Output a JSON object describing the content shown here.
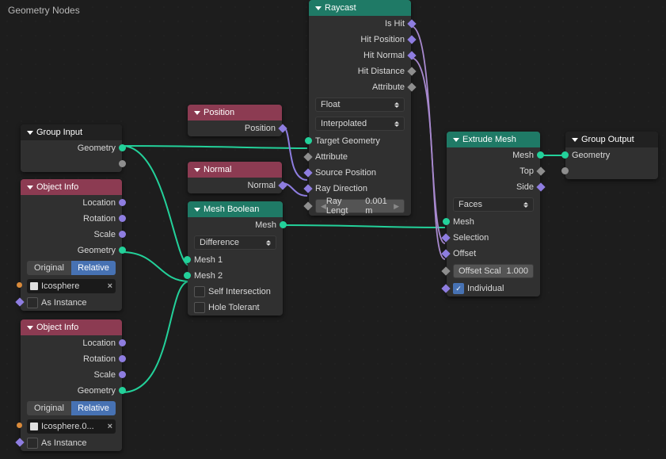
{
  "editor_title": "Geometry Nodes",
  "group_input": {
    "title": "Group Input",
    "out_geometry": "Geometry"
  },
  "object_info_1": {
    "title": "Object Info",
    "location": "Location",
    "rotation": "Rotation",
    "scale": "Scale",
    "geometry": "Geometry",
    "toggle_original": "Original",
    "toggle_relative": "Relative",
    "object_name": "Icosphere",
    "as_instance": "As Instance"
  },
  "object_info_2": {
    "title": "Object Info",
    "location": "Location",
    "rotation": "Rotation",
    "scale": "Scale",
    "geometry": "Geometry",
    "toggle_original": "Original",
    "toggle_relative": "Relative",
    "object_name": "Icosphere.0...",
    "as_instance": "As Instance"
  },
  "position": {
    "title": "Position",
    "out": "Position"
  },
  "normal": {
    "title": "Normal",
    "out": "Normal"
  },
  "mesh_boolean": {
    "title": "Mesh Boolean",
    "out_mesh": "Mesh",
    "mode": "Difference",
    "mesh1": "Mesh 1",
    "mesh2": "Mesh 2",
    "self_intersection": "Self Intersection",
    "hole_tolerant": "Hole Tolerant"
  },
  "raycast": {
    "title": "Raycast",
    "is_hit": "Is Hit",
    "hit_position": "Hit Position",
    "hit_normal": "Hit Normal",
    "hit_distance": "Hit Distance",
    "attribute": "Attribute",
    "data_type": "Float",
    "interp": "Interpolated",
    "target_geometry": "Target Geometry",
    "in_attribute": "Attribute",
    "source_position": "Source Position",
    "ray_direction": "Ray Direction",
    "ray_length_label": "Ray Lengt",
    "ray_length_val": "0.001 m"
  },
  "extrude": {
    "title": "Extrude Mesh",
    "out_mesh": "Mesh",
    "out_top": "Top",
    "out_side": "Side",
    "mode": "Faces",
    "in_mesh": "Mesh",
    "selection": "Selection",
    "offset": "Offset",
    "offset_scale_label": "Offset Scal",
    "offset_scale_val": "1.000",
    "individual": "Individual"
  },
  "group_output": {
    "title": "Group Output",
    "in_geometry": "Geometry"
  }
}
